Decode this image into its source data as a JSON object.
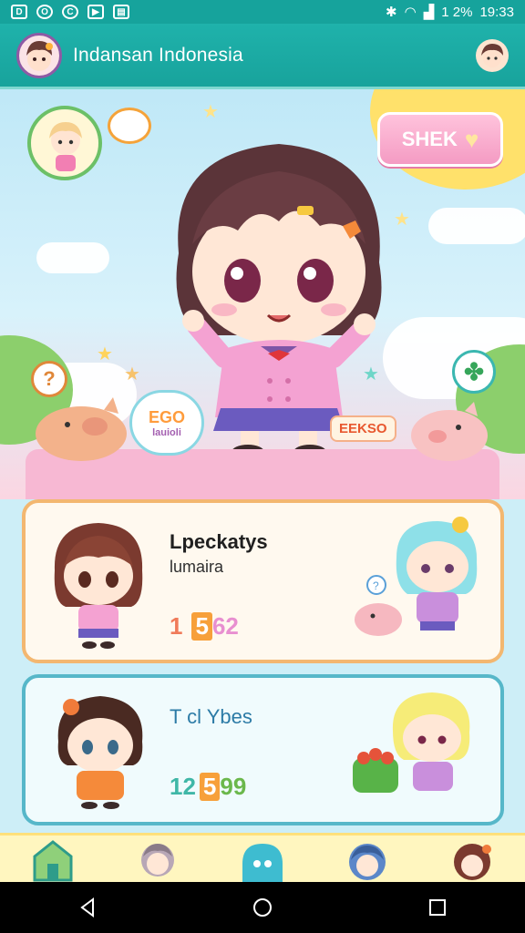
{
  "status_bar": {
    "left_icons": [
      "d-icon",
      "o-icon",
      "c-icon",
      "message-icon",
      "image-icon"
    ],
    "signal_text": "1 2%",
    "time": "19:33"
  },
  "app_bar": {
    "title": "Indansan Indonesia"
  },
  "hero": {
    "action_label": "SHEK",
    "sticker_main": "EGO",
    "sticker_sub": "lauioli",
    "tag_label": "EEKSO",
    "question_mark": "?"
  },
  "cards": [
    {
      "title": "Lpeckatys",
      "subtitle": "lumaira",
      "score_prefix": "1",
      "score_box": "5",
      "score_suffix": "62"
    },
    {
      "title": "T cl Ybes",
      "subtitle": "",
      "score_prefix": "12",
      "score_box": "5",
      "score_suffix": "99"
    }
  ],
  "bottom_nav": [
    "home-icon",
    "profile-icon",
    "chat-icon",
    "friends-icon",
    "avatar-icon"
  ],
  "colors": {
    "status_bar": "#16a39c",
    "card_one_border": "#f3b770",
    "card_two_border": "#56b7c9",
    "action_button": "#f49bc3"
  }
}
